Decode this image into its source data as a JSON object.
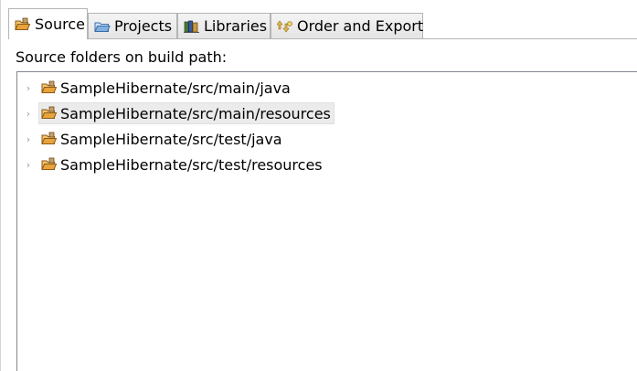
{
  "tabs": [
    {
      "label": "Source",
      "icon": "source-folder-icon",
      "active": true
    },
    {
      "label": "Projects",
      "icon": "projects-icon",
      "active": false
    },
    {
      "label": "Libraries",
      "icon": "libraries-icon",
      "active": false
    },
    {
      "label": "Order and Export",
      "icon": "order-export-icon",
      "active": false
    }
  ],
  "source_panel": {
    "heading": "Source folders on build path:",
    "folders": [
      {
        "label": "SampleHibernate/src/main/java",
        "selected": false
      },
      {
        "label": "SampleHibernate/src/main/resources",
        "selected": true
      },
      {
        "label": "SampleHibernate/src/test/java",
        "selected": false
      },
      {
        "label": "SampleHibernate/src/test/resources",
        "selected": false
      }
    ]
  },
  "colors": {
    "selection_bg": "#ebebeb",
    "tab_border": "#b4b4b4",
    "folder_orange": "#e8a33a",
    "folder_brown": "#8b5a1a"
  }
}
